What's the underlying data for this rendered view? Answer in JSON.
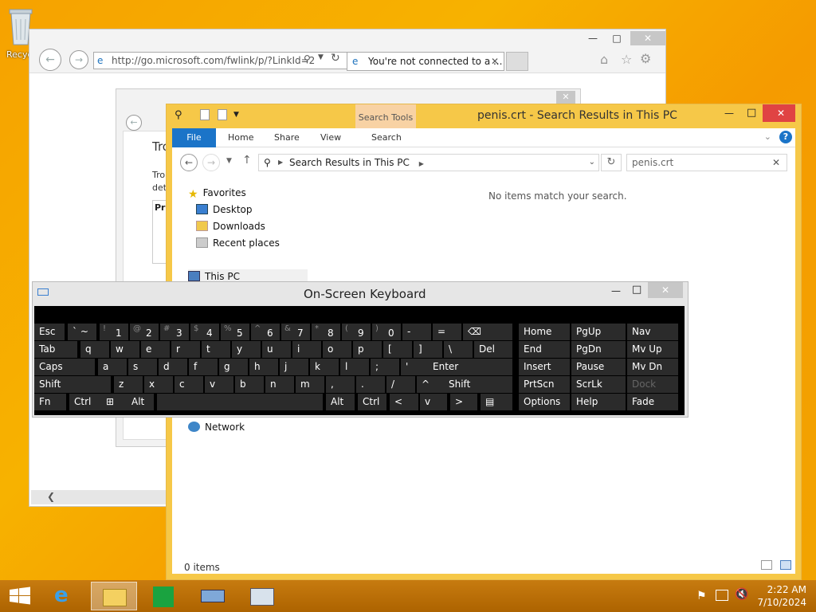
{
  "desktop": {
    "recycle_bin_label": "Recyc"
  },
  "ie": {
    "address": "http://go.microsoft.com/fwlink/p/?LinkId=2",
    "address_host": "microsoft",
    "tab_title": "You're not connected to a ...",
    "page_heading": "Tro",
    "page_text1": "Tro",
    "page_text2": "det",
    "page_box": "Pro"
  },
  "explorer": {
    "title": "penis.crt - Search Results in This PC",
    "context_tab": "Search Tools",
    "ribbon_tabs": [
      "File",
      "Home",
      "Share",
      "View",
      "Search"
    ],
    "breadcrumb": "Search Results in This PC",
    "search_value": "penis.crt",
    "nav": {
      "favorites": "Favorites",
      "desktop": "Desktop",
      "downloads": "Downloads",
      "recent": "Recent places",
      "this_pc": "This PC",
      "network": "Network"
    },
    "empty_message": "No items match your search.",
    "status": "0 items"
  },
  "osk": {
    "title": "On-Screen Keyboard",
    "rows": [
      [
        "Esc",
        "` ~",
        "1",
        "2",
        "3",
        "4",
        "5",
        "6",
        "7",
        "8",
        "9",
        "0",
        "-",
        "=",
        "⌫"
      ],
      [
        "Tab",
        "q",
        "w",
        "e",
        "r",
        "t",
        "y",
        "u",
        "i",
        "o",
        "p",
        "[",
        "]",
        "\\",
        "Del"
      ],
      [
        "Caps",
        "a",
        "s",
        "d",
        "f",
        "g",
        "h",
        "j",
        "k",
        "l",
        ";",
        "'",
        "Enter"
      ],
      [
        "Shift",
        "z",
        "x",
        "c",
        "v",
        "b",
        "n",
        "m",
        ",",
        ".",
        "/",
        "^",
        "Shift"
      ],
      [
        "Fn",
        "Ctrl",
        "⊞",
        "Alt",
        "",
        "Alt",
        "Ctrl",
        "<",
        "v",
        ">",
        "▤"
      ]
    ],
    "nav_keys": [
      [
        "Home",
        "PgUp",
        "Nav"
      ],
      [
        "End",
        "PgDn",
        "Mv Up"
      ],
      [
        "Insert",
        "Pause",
        "Mv Dn"
      ],
      [
        "PrtScn",
        "ScrLk",
        "Dock"
      ],
      [
        "Options",
        "Help",
        "Fade"
      ]
    ],
    "shifted": {
      "2": "@",
      "3": "#",
      "4": "$",
      "5": "%",
      "6": "^",
      "7": "&",
      "8": "*",
      "9": "(",
      "0": ")",
      "1": "!"
    }
  },
  "taskbar": {
    "time": "2:22 AM",
    "date": "7/10/2024"
  }
}
